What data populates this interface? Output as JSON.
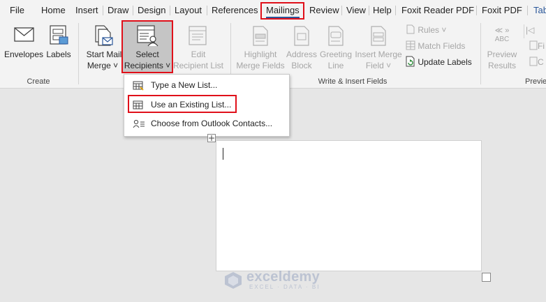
{
  "tabs": [
    "File",
    "Home",
    "Insert",
    "Draw",
    "Design",
    "Layout",
    "References",
    "Mailings",
    "Review",
    "View",
    "Help",
    "Foxit Reader PDF",
    "Foxit PDF",
    "Tab"
  ],
  "active_tab": "Mailings",
  "groups": {
    "create": "Create",
    "write_insert": "Write & Insert Fields",
    "preview": "Previe"
  },
  "buttons": {
    "envelopes": "Envelopes",
    "labels": "Labels",
    "start_mail_merge_1": "Start Mail",
    "start_mail_merge_2": "Merge",
    "select_recipients_1": "Select",
    "select_recipients_2": "Recipients",
    "edit_recipient_list_1": "Edit",
    "edit_recipient_list_2": "Recipient List",
    "highlight_merge_fields_1": "Highlight",
    "highlight_merge_fields_2": "Merge Fields",
    "address_block_1": "Address",
    "address_block_2": "Block",
    "greeting_line_1": "Greeting",
    "greeting_line_2": "Line",
    "insert_merge_field_1": "Insert Merge",
    "insert_merge_field_2": "Field",
    "rules": "Rules",
    "match_fields": "Match Fields",
    "update_labels": "Update Labels",
    "preview_results_1": "Preview",
    "preview_results_2": "Results",
    "abc": "ABC",
    "find_recipient_cut": "Fi",
    "check_errors_cut": "C"
  },
  "menu": {
    "items": [
      "Type a New List...",
      "Use an Existing List...",
      "Choose from Outlook Contacts..."
    ]
  },
  "watermark": {
    "name": "exceldemy",
    "sub": "EXCEL · DATA · BI"
  },
  "colors": {
    "accent": "#2b579a",
    "highlight_box": "#e0101a",
    "disabled": "#a6a6a6"
  }
}
